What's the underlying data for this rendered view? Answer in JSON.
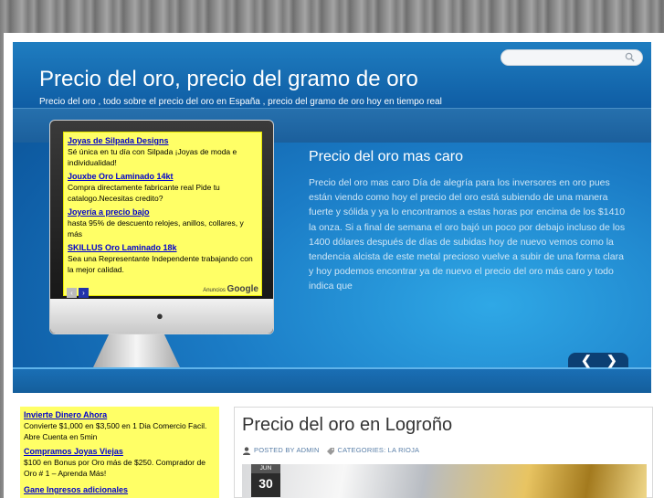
{
  "header": {
    "title": "Precio del oro, precio del gramo de oro",
    "description": "Precio del oro , todo sobre el precio del oro en España , precio del gramo de oro hoy en tiempo real",
    "search": {
      "placeholder": "",
      "icon": "search-icon"
    }
  },
  "slider": {
    "ads": [
      {
        "link": "Joyas de Silpada Designs",
        "text": "Sé única en tu día con Silpada ¡Joyas de moda e individualidad!"
      },
      {
        "link": "Jouxbe Oro Laminado 14kt",
        "text": "Compra directamente fabricante real Pide tu catalogo.Necesitas credito?"
      },
      {
        "link": "Joyería a precio bajo",
        "text": "hasta 95% de descuento relojes, anillos, collares, y más"
      },
      {
        "link": "SKILLUS Oro Laminado 18k",
        "text": "Sea una Representante Independente trabajando con la mejor calidad."
      }
    ],
    "ad_nav": {
      "prev": "‹",
      "next": "›"
    },
    "ad_badge_prefix": "Anuncios",
    "ad_badge_brand": "Google",
    "post_title": "Precio del oro mas caro",
    "post_excerpt": "Precio del oro mas caro Día de alegría para los inversores en oro pues están viendo como hoy el precio del oro está subiendo de una manera fuerte y sólida y ya lo encontramos a estas horas por encima de los $1410 la onza. Si a final de semana el oro bajó un poco por debajo incluso de los 1400 dólares después de días de subidas hoy de nuevo vemos como la tendencia alcista de este metal precioso vuelve a subir de una forma clara y hoy podemos encontrar ya de nuevo el precio del oro más caro y todo indica que",
    "nav_prev": "❮",
    "nav_next": "❯"
  },
  "sidebar_ads": [
    {
      "link": "Invierte Dinero Ahora",
      "text": "Convierte $1,000 en $3,500 en 1 Dia Comercio Facil. Abre Cuenta en 5min"
    },
    {
      "link": "Compramos Joyas Viejas",
      "text": "$100 en Bonus por Oro más de $250. Comprador de Oro # 1 – Aprenda Más!"
    },
    {
      "link": "Gane Ingresos adicionales",
      "text": ""
    }
  ],
  "post": {
    "title": "Precio del oro en Logroño",
    "posted_by": "POSTED BY ADMIN",
    "categories": "CATEGORIES: LA RIOJA",
    "date_month": "JUN",
    "date_day": "30"
  }
}
